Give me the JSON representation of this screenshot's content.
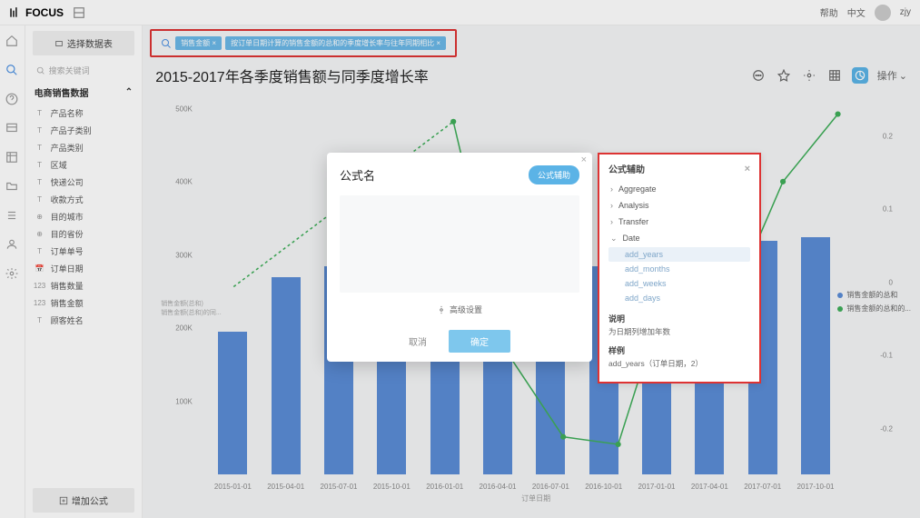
{
  "header": {
    "brand": "FOCUS",
    "help": "帮助",
    "lang": "中文",
    "user": "zjy"
  },
  "sidebar": {
    "select_data_table": "选择数据表",
    "search_placeholder": "搜索关键词",
    "datasource": "电商销售数据",
    "fields": [
      {
        "icon": "T",
        "label": "产品名称"
      },
      {
        "icon": "T",
        "label": "产品子类别"
      },
      {
        "icon": "T",
        "label": "产品类别"
      },
      {
        "icon": "T",
        "label": "区域"
      },
      {
        "icon": "T",
        "label": "快递公司"
      },
      {
        "icon": "T",
        "label": "收款方式"
      },
      {
        "icon": "⊕",
        "label": "目的城市"
      },
      {
        "icon": "⊕",
        "label": "目的省份"
      },
      {
        "icon": "T",
        "label": "订单单号"
      },
      {
        "icon": "📅",
        "label": "订单日期"
      },
      {
        "icon": "123",
        "label": "销售数量"
      },
      {
        "icon": "123",
        "label": "销售金额"
      },
      {
        "icon": "T",
        "label": "顾客姓名"
      }
    ],
    "add_formula": "增加公式"
  },
  "search": {
    "chips": [
      "销售金额 ×",
      "按订单日期计算的销售金额的总和的季度增长率与往年同期相比 ×"
    ]
  },
  "chart": {
    "title": "2015-2017年各季度销售额与同季度增长率",
    "ops_label": "操作",
    "y_ticks": [
      "500K",
      "400K",
      "300K",
      "200K",
      "100K"
    ],
    "y2_ticks": [
      "0.2",
      "0.1",
      "0",
      "-0.1",
      "-0.2"
    ],
    "x_axis_title": "订单日期",
    "legend": [
      {
        "color": "#5b8dd6",
        "label": "销售金额的总和"
      },
      {
        "color": "#3fae5a",
        "label": "销售金额的总和的..."
      }
    ],
    "metric_labels": [
      "销售金额(总和)",
      "销售金额(总和)的同..."
    ]
  },
  "chart_data": {
    "type": "bar+line",
    "categories": [
      "2015-01-01",
      "2015-04-01",
      "2015-07-01",
      "2015-10-01",
      "2016-01-01",
      "2016-04-01",
      "2016-07-01",
      "2016-10-01",
      "2017-01-01",
      "2017-04-01",
      "2017-07-01",
      "2017-10-01"
    ],
    "series": [
      {
        "name": "销售金额的总和",
        "type": "bar",
        "axis": "left",
        "values": [
          195000,
          270000,
          285000,
          310000,
          290000,
          270000,
          265000,
          285000,
          255000,
          265000,
          320000,
          325000
        ]
      },
      {
        "name": "销售金额的总和的季度增长率",
        "type": "line",
        "axis": "right",
        "values": [
          null,
          null,
          null,
          null,
          0.22,
          -0.09,
          -0.2,
          -0.21,
          0.02,
          -0.03,
          0.14,
          0.23
        ]
      }
    ],
    "ylabel": "销售金额(总和)",
    "ylim": [
      0,
      500000
    ],
    "y2lim": [
      -0.25,
      0.25
    ],
    "xlabel": "订单日期"
  },
  "modal": {
    "title": "公式名",
    "helper_btn": "公式辅助",
    "advanced": "高级设置",
    "cancel": "取消",
    "confirm": "确定"
  },
  "helper": {
    "title": "公式辅助",
    "categories": [
      "Aggregate",
      "Analysis",
      "Transfer",
      "Date"
    ],
    "date_fns": [
      "add_years",
      "add_months",
      "add_weeks",
      "add_days"
    ],
    "desc_title": "说明",
    "desc_text": "为日期列增加年数",
    "example_title": "样例",
    "example_text": "add_years（订单日期，2）"
  }
}
